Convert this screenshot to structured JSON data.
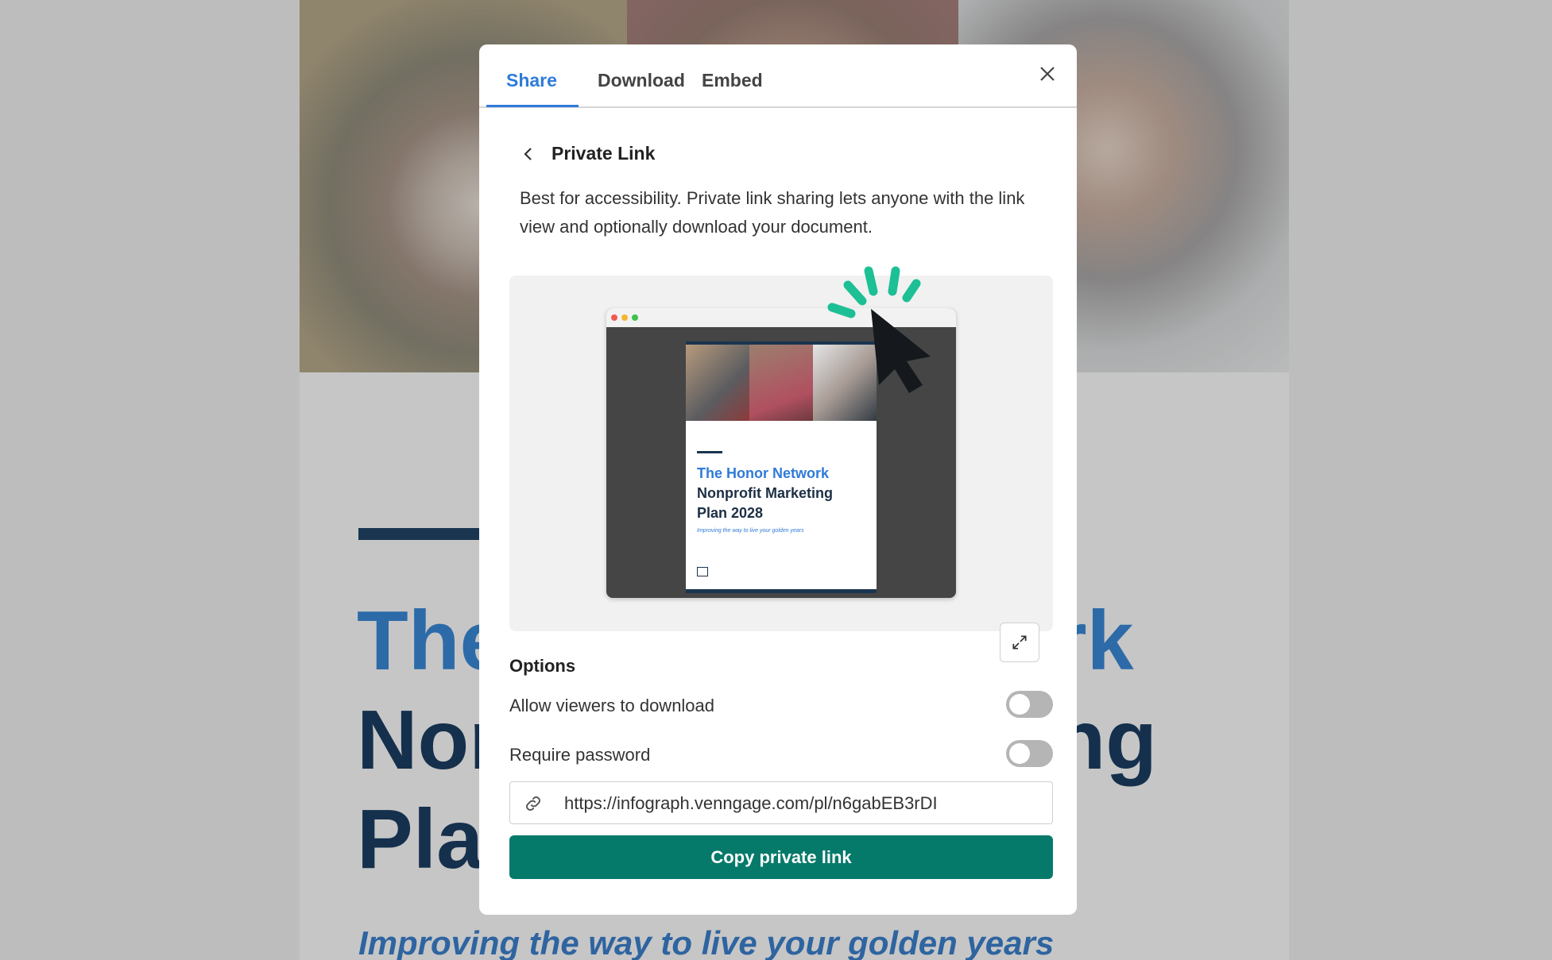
{
  "background_document": {
    "title_line1": "The Honor Network",
    "title_line2": "Nonprofit Marketing",
    "title_line3": "Plan 2028",
    "subtitle": "Improving the way to live your golden years"
  },
  "modal": {
    "tabs": [
      {
        "label": "Share",
        "active": true
      },
      {
        "label": "Download",
        "active": false
      },
      {
        "label": "Embed",
        "active": false
      }
    ],
    "close_icon": "close-x-icon",
    "back_icon": "chevron-left-icon",
    "heading": "Private Link",
    "description": "Best for accessibility. Private link sharing lets anyone with the link view and optionally download your document.",
    "preview": {
      "doc_title_line1": "The Honor Network",
      "doc_title_line2": "Nonprofit Marketing",
      "doc_title_line3": "Plan 2028",
      "doc_subtitle": "Improving the way to live your golden years",
      "expand_icon": "expand-arrows-icon"
    },
    "options": {
      "title": "Options",
      "items": [
        {
          "label": "Allow viewers to download",
          "enabled": false
        },
        {
          "label": "Require password",
          "enabled": false
        }
      ]
    },
    "link": {
      "icon": "link-icon",
      "value": "https://infograph.venngage.com/pl/n6gabEB3rDI"
    },
    "copy_button": "Copy private link"
  },
  "colors": {
    "accent_blue": "#2f7bd9",
    "primary_button": "#067a6a",
    "spark_green": "#1dbf94",
    "doc_navy": "#1a3550"
  }
}
